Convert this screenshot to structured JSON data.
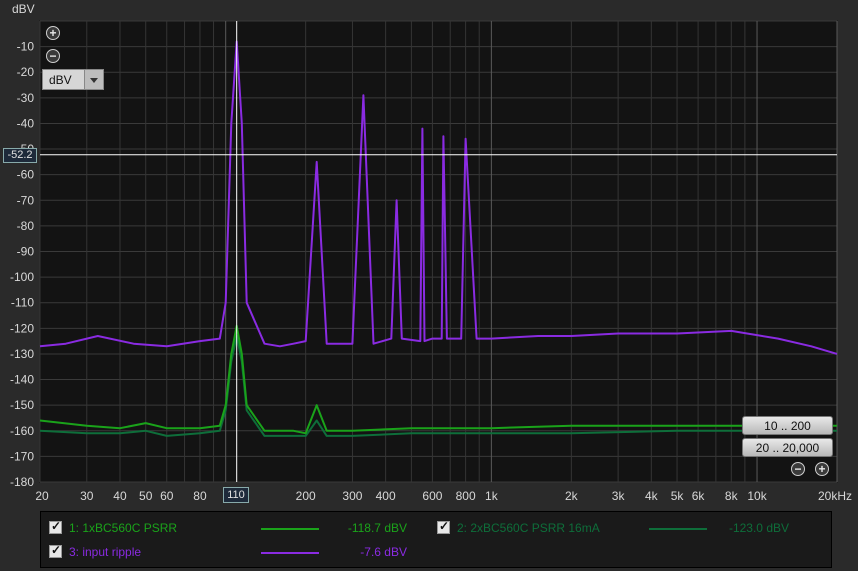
{
  "chart_data": {
    "type": "line",
    "ylabel": "dBV",
    "xunit": "kHz",
    "x_scale": "log",
    "xlim": [
      20,
      20000
    ],
    "ylim": [
      -180,
      0
    ],
    "grid": true,
    "y_ticks": [
      "-10",
      "-20",
      "-30",
      "-40",
      "-50",
      "-60",
      "-70",
      "-80",
      "-90",
      "-100",
      "-110",
      "-120",
      "-130",
      "-140",
      "-150",
      "-160",
      "-170",
      "-180"
    ],
    "x_ticks": [
      {
        "v": 20,
        "label": "20"
      },
      {
        "v": 30,
        "label": "30"
      },
      {
        "v": 40,
        "label": "40"
      },
      {
        "v": 50,
        "label": "50"
      },
      {
        "v": 60,
        "label": "60"
      },
      {
        "v": 80,
        "label": "80"
      },
      {
        "v": 100,
        "label": "1"
      },
      {
        "v": 200,
        "label": "200"
      },
      {
        "v": 300,
        "label": "300"
      },
      {
        "v": 400,
        "label": "400"
      },
      {
        "v": 600,
        "label": "600"
      },
      {
        "v": 800,
        "label": "800"
      },
      {
        "v": 1000,
        "label": "1k"
      },
      {
        "v": 2000,
        "label": "2k"
      },
      {
        "v": 3000,
        "label": "3k"
      },
      {
        "v": 4000,
        "label": "4k"
      },
      {
        "v": 5000,
        "label": "5k"
      },
      {
        "v": 6000,
        "label": "6k"
      },
      {
        "v": 8000,
        "label": "8k"
      },
      {
        "v": 10000,
        "label": "10k"
      },
      {
        "v": 20000,
        "label": "20kHz"
      }
    ],
    "cursor": {
      "x": 110,
      "y": -52.2,
      "x_label": "110",
      "y_label": "-52.2"
    },
    "series": [
      {
        "name": "3: input ripple",
        "color": "#8a2be2",
        "value": "-7.6 dBV",
        "x": [
          20,
          25,
          33,
          45,
          60,
          80,
          95,
          100,
          105,
          110,
          115,
          120,
          140,
          160,
          180,
          200,
          220,
          240,
          300,
          330,
          360,
          420,
          440,
          460,
          540,
          550,
          560,
          600,
          650,
          660,
          680,
          770,
          800,
          880,
          1000,
          1500,
          2000,
          3000,
          5000,
          8000,
          12000,
          16000,
          20000
        ],
        "y": [
          -127,
          -126,
          -123,
          -126,
          -127,
          -125,
          -124,
          -110,
          -40,
          -8,
          -40,
          -110,
          -126,
          -127,
          -126,
          -125,
          -55,
          -126,
          -126,
          -29,
          -126,
          -124,
          -70,
          -124,
          -125,
          -42,
          -125,
          -124,
          -124,
          -45,
          -124,
          -124,
          -46,
          -124,
          -124,
          -123,
          -123,
          -122,
          -122,
          -121,
          -124,
          -127,
          -130
        ]
      },
      {
        "name": "1: 1xBC560C PSRR",
        "color": "#1aa31a",
        "value": "-118.7 dBV",
        "x": [
          20,
          30,
          40,
          50,
          60,
          80,
          95,
          100,
          105,
          110,
          115,
          120,
          140,
          180,
          200,
          220,
          240,
          300,
          500,
          1000,
          2000,
          5000,
          10000,
          20000
        ],
        "y": [
          -156,
          -158,
          -159,
          -157,
          -159,
          -159,
          -158,
          -150,
          -130,
          -119,
          -130,
          -150,
          -160,
          -160,
          -161,
          -150,
          -160,
          -160,
          -159,
          -159,
          -158,
          -158,
          -158,
          -158
        ]
      },
      {
        "name": "2: 2xBC560C PSRR 16mA",
        "color": "#0e6e3a",
        "value": "-123.0 dBV",
        "x": [
          20,
          30,
          40,
          50,
          60,
          80,
          95,
          100,
          105,
          110,
          115,
          120,
          140,
          180,
          200,
          220,
          240,
          300,
          500,
          1000,
          2000,
          5000,
          10000,
          20000
        ],
        "y": [
          -160,
          -161,
          -161,
          -160,
          -162,
          -161,
          -160,
          -152,
          -133,
          -123,
          -133,
          -152,
          -162,
          -162,
          -162,
          -156,
          -162,
          -162,
          -161,
          -161,
          -161,
          -160,
          -160,
          -160
        ]
      }
    ]
  },
  "controls": {
    "unit_select": "dBV",
    "range_buttons": [
      "10 .. 200",
      "20 .. 20,000"
    ]
  }
}
